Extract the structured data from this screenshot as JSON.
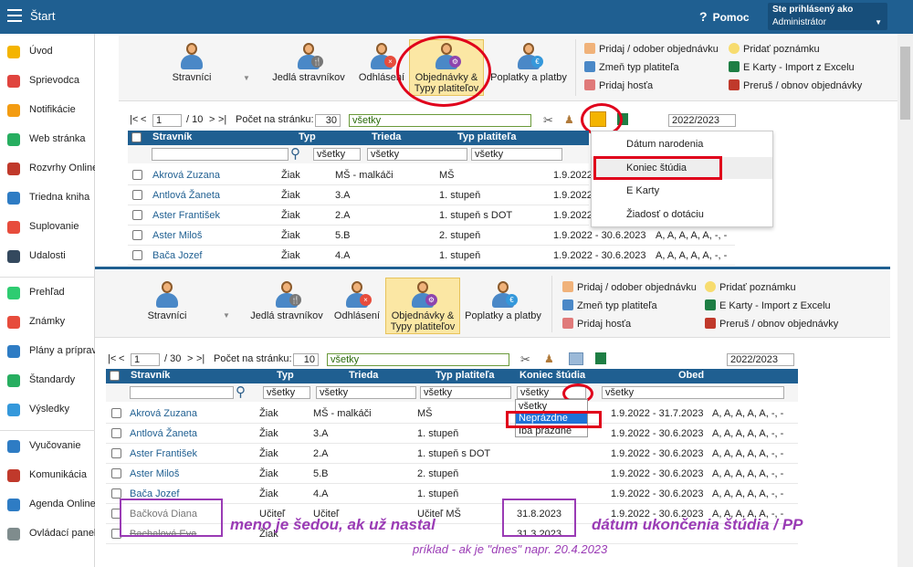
{
  "topbar": {
    "title": "Štart",
    "help": "Pomoc",
    "help_icon": "?",
    "user_line1": "Ste prihlásený ako",
    "user_line2": "Administrátor"
  },
  "sidebar": {
    "items": [
      {
        "label": "Úvod",
        "color": "#f4b400",
        "icon": "star-icon"
      },
      {
        "label": "Sprievodca",
        "color": "#e0443e",
        "icon": "wand-icon"
      },
      {
        "label": "Notifikácie",
        "color": "#f39c12",
        "icon": "envelope-icon"
      },
      {
        "label": "Web stránka",
        "color": "#27ae60",
        "icon": "home-icon"
      },
      {
        "label": "Rozvrhy Online",
        "color": "#c0392b",
        "icon": "calendar-icon"
      },
      {
        "label": "Triedna kniha",
        "color": "#2e7cc4",
        "icon": "book-icon"
      },
      {
        "label": "Suplovanie",
        "color": "#e74c3c",
        "icon": "user-icon"
      },
      {
        "label": "Udalosti",
        "color": "#34495e",
        "icon": "calendar-icon"
      },
      {
        "label": "Prehľad",
        "color": "#2ecc71",
        "icon": "check-icon"
      },
      {
        "label": "Známky",
        "color": "#e74c3c",
        "icon": "grade-icon"
      },
      {
        "label": "Plány a prípravy",
        "color": "#2e7cc4",
        "icon": "briefcase-icon"
      },
      {
        "label": "Štandardy",
        "color": "#27ae60",
        "icon": "shield-icon"
      },
      {
        "label": "Výsledky",
        "color": "#3498db",
        "icon": "chart-icon"
      },
      {
        "label": "Vyučovanie",
        "color": "#2e7cc4",
        "icon": "book-icon"
      },
      {
        "label": "Komunikácia",
        "color": "#c0392b",
        "icon": "chat-icon"
      },
      {
        "label": "Agenda Online",
        "color": "#2e7cc4",
        "icon": "pen-icon"
      },
      {
        "label": "Ovládací panel",
        "color": "#7f8c8d",
        "icon": "gear-icon"
      }
    ]
  },
  "ribbon": {
    "stravnici": "Stravníci",
    "jedla": "Jedlá stravníkov",
    "odhlaseni": "Odhlásení",
    "objednavky_1": "Objednávky &",
    "objednavky_2": "Typy platiteľov",
    "poplatky": "Poplatky a platby",
    "pridaj_odober": "Pridaj / odober objednávku",
    "zmen_typ": "Zmeň typ platiteľa",
    "pridaj_host": "Pridaj hosťa",
    "pridat_poznamku": "Pridať poznámku",
    "ekarty": "E Karty - Import z Excelu",
    "prerus": "Preruš / obnov objednávky"
  },
  "top": {
    "pager": {
      "first": "|<",
      "prev": "<",
      "page": "1",
      "of": "/ 10",
      "next": ">",
      "last": ">|",
      "per_page_label": "Počet na stránku:",
      "per_page": "30",
      "filter": "všetky",
      "year": "2022/2023"
    },
    "columns": [
      "Stravník",
      "Typ",
      "Trieda",
      "Typ platiteľa"
    ],
    "filters": [
      "všetky",
      "všetky",
      "všetky"
    ],
    "rows": [
      {
        "name": "Akrová Zuzana",
        "typ": "Žiak",
        "trieda": "MŠ - malkáči",
        "platitel": "MŠ",
        "obdobie": "1.9.2022"
      },
      {
        "name": "Antlová Žaneta",
        "typ": "Žiak",
        "trieda": "3.A",
        "platitel": "1. stupeň",
        "obdobie": "1.9.2022"
      },
      {
        "name": "Aster František",
        "typ": "Žiak",
        "trieda": "2.A",
        "platitel": "1. stupeň s DOT",
        "obdobie": "1.9.2022"
      },
      {
        "name": "Aster Miloš",
        "typ": "Žiak",
        "trieda": "5.B",
        "platitel": "2. stupeň",
        "obdobie": "1.9.2022 - 30.6.2023",
        "obed": "A, A, A, A, A, -, -"
      },
      {
        "name": "Bača Jozef",
        "typ": "Žiak",
        "trieda": "4.A",
        "platitel": "1. stupeň",
        "obdobie": "1.9.2022 - 30.6.2023",
        "obed": "A, A, A, A, A, -, -"
      }
    ],
    "dropdown": [
      "Dátum narodenia",
      "Koniec štúdia",
      "E Karty",
      "Žiadosť o dotáciu"
    ]
  },
  "bottom": {
    "pager": {
      "first": "|<",
      "prev": "<",
      "page": "1",
      "of": "/ 30",
      "next": ">",
      "last": ">|",
      "per_page_label": "Počet na stránku:",
      "per_page": "10",
      "filter": "všetky",
      "year": "2022/2023"
    },
    "columns": [
      "Stravník",
      "Typ",
      "Trieda",
      "Typ platiteľa",
      "Koniec štúdia",
      "Obed"
    ],
    "filters": [
      "všetky",
      "všetky",
      "všetky",
      "všetky",
      "všetky"
    ],
    "koniec_options": [
      "všetky",
      "Neprázdne",
      "Iba prázdne"
    ],
    "rows": [
      {
        "name": "Akrová Zuzana",
        "typ": "Žiak",
        "trieda": "MŠ - malkáči",
        "platitel": "MŠ",
        "koniec": "",
        "obdobie": "1.9.2022 - 31.7.2023",
        "obed": "A, A, A, A, A, -, -"
      },
      {
        "name": "Antlová Žaneta",
        "typ": "Žiak",
        "trieda": "3.A",
        "platitel": "1. stupeň",
        "koniec": "",
        "obdobie": "1.9.2022 - 30.6.2023",
        "obed": "A, A, A, A, A, -, -"
      },
      {
        "name": "Aster František",
        "typ": "Žiak",
        "trieda": "2.A",
        "platitel": "1. stupeň s DOT",
        "koniec": "",
        "obdobie": "1.9.2022 - 30.6.2023",
        "obed": "A, A, A, A, A, -, -"
      },
      {
        "name": "Aster Miloš",
        "typ": "Žiak",
        "trieda": "5.B",
        "platitel": "2. stupeň",
        "koniec": "",
        "obdobie": "1.9.2022 - 30.6.2023",
        "obed": "A, A, A, A, A, -, -"
      },
      {
        "name": "Bača Jozef",
        "typ": "Žiak",
        "trieda": "4.A",
        "platitel": "1. stupeň",
        "koniec": "",
        "obdobie": "1.9.2022 - 30.6.2023",
        "obed": "A, A, A, A, A, -, -"
      },
      {
        "name": "Bačková Diana",
        "typ": "Učiteľ",
        "trieda": "Učiteľ",
        "platitel": "Učiteľ MŠ",
        "koniec": "31.8.2023",
        "obdobie": "1.9.2022 - 30.6.2023",
        "obed": "A, A, A, A, A, -, -"
      },
      {
        "name": "Bachalová Eva",
        "typ": "Žiak",
        "trieda": "",
        "platitel": "",
        "koniec": "31.3.2023",
        "obdobie": "",
        "obed": ""
      }
    ]
  },
  "annotations": {
    "meno": "meno je šedou, ak už nastal",
    "datum": "dátum ukončenia štúdia / PP",
    "priklad": "príklad - ak je \"dnes\" napr. 20.4.2023"
  }
}
